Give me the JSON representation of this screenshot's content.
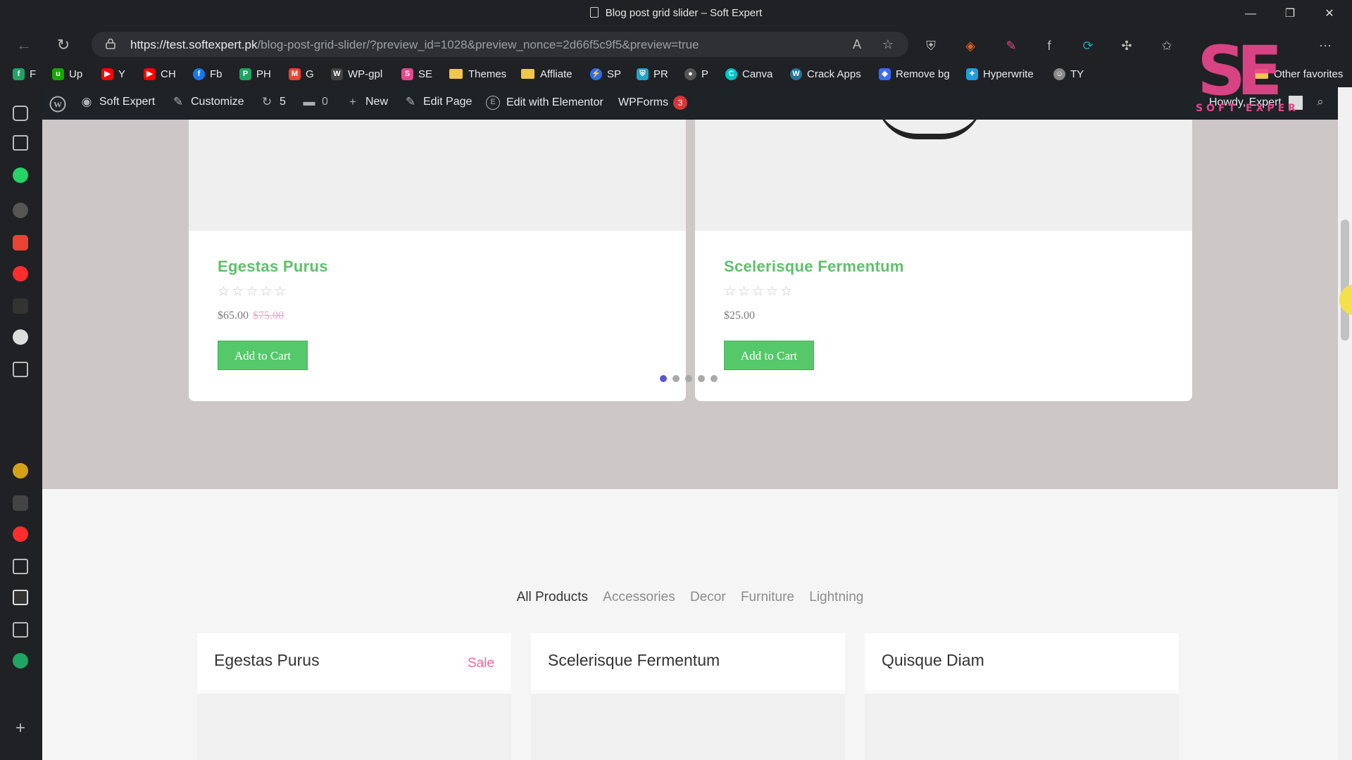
{
  "window": {
    "title": "Blog post grid slider – Soft Expert"
  },
  "address": {
    "url_host": "https://test.softexpert.pk",
    "url_path": "/blog-post-grid-slider/?preview_id=1028&preview_nonce=2d66f5c9f5&preview=true"
  },
  "bookmarks": [
    {
      "label": "F",
      "color": "#1fa463"
    },
    {
      "label": "Up",
      "color": "#14a800"
    },
    {
      "label": "Y",
      "color": "#ff0000"
    },
    {
      "label": "CH",
      "color": "#ff0000"
    },
    {
      "label": "Fb",
      "color": "#1877f2"
    },
    {
      "label": "PH",
      "color": "#1fa463"
    },
    {
      "label": "G",
      "color": "#ea4335"
    },
    {
      "label": "WP-gpl",
      "color": "#444444"
    },
    {
      "label": "SE",
      "color": "#e24a8d"
    },
    {
      "label": "Themes",
      "color": "#f0c74a"
    },
    {
      "label": "Affliate",
      "color": "#f0c74a"
    },
    {
      "label": "SP",
      "color": "#2b6cf6"
    },
    {
      "label": "PR",
      "color": "#1fa4c4"
    },
    {
      "label": "P",
      "color": "#555555"
    },
    {
      "label": "Canva",
      "color": "#00c4cc"
    },
    {
      "label": "Crack Apps",
      "color": "#21759b"
    },
    {
      "label": "Remove bg",
      "color": "#3b6cf6"
    },
    {
      "label": "Hyperwrite",
      "color": "#1aa0e0"
    },
    {
      "label": "TY",
      "color": "#888888"
    },
    {
      "label": "Other favorites",
      "color": "#f0c74a"
    }
  ],
  "wpbar": {
    "site": "Soft Expert",
    "customize": "Customize",
    "updates": "5",
    "comments": "0",
    "new": "New",
    "edit_page": "Edit Page",
    "elementor": "Edit with Elementor",
    "wpforms": "WPForms",
    "wpforms_count": "3",
    "howdy": "Howdy, Expert"
  },
  "slider": {
    "cards": [
      {
        "name": "Egestas Purus",
        "stars": "☆☆☆☆☆",
        "price": "$65.00",
        "old_price": "$75.00",
        "button": "Add to Cart"
      },
      {
        "name": "Scelerisque Fermentum",
        "stars": "☆☆☆☆☆",
        "price": "$25.00",
        "old_price": "",
        "button": "Add to Cart"
      }
    ],
    "dots": 5,
    "active_dot": 0
  },
  "filter_tabs": [
    "All Products",
    "Accessories",
    "Decor",
    "Furniture",
    "Lightning"
  ],
  "products": [
    {
      "name": "Egestas Purus",
      "badge": "Sale"
    },
    {
      "name": "Scelerisque Fermentum",
      "badge": ""
    },
    {
      "name": "Quisque Diam",
      "badge": ""
    }
  ],
  "colors": {
    "accent_green": "#5fc06c",
    "button_green": "#55c86a",
    "sale_pink": "#f06a9c",
    "dot_active": "#5b57d9"
  }
}
